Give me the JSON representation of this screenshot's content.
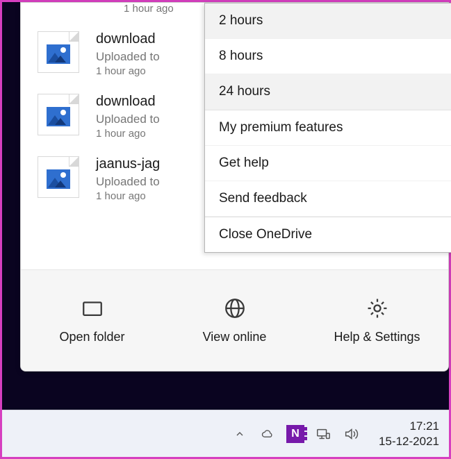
{
  "files": [
    {
      "name": "",
      "status": "",
      "time": "1 hour ago"
    },
    {
      "name": "download",
      "status": "Uploaded to",
      "time": "1 hour ago"
    },
    {
      "name": "download",
      "status": "Uploaded to",
      "time": "1 hour ago"
    },
    {
      "name": "jaanus-jag",
      "status": "Uploaded to",
      "time": "1 hour ago"
    }
  ],
  "menu": {
    "items": [
      {
        "label": "2 hours",
        "hovered": true
      },
      {
        "label": "8 hours",
        "hovered": false
      },
      {
        "label": "24 hours",
        "hovered": true
      },
      {
        "label": "My premium features",
        "hovered": false
      },
      {
        "label": "Get help",
        "hovered": false
      },
      {
        "label": "Send feedback",
        "hovered": false
      },
      {
        "label": "Close OneDrive",
        "hovered": false
      }
    ]
  },
  "bottom": {
    "open_folder": "Open folder",
    "view_online": "View online",
    "help_settings": "Help & Settings"
  },
  "taskbar": {
    "time": "17:21",
    "date": "15-12-2021"
  }
}
